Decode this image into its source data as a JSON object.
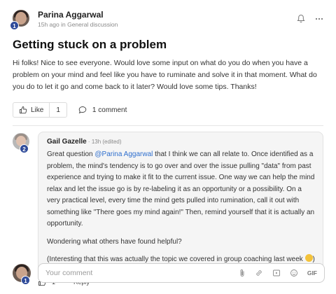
{
  "post": {
    "author": "Parina Aggarwal",
    "author_badge": "1",
    "timestamp": "15h ago in",
    "group": "General discussion",
    "title": "Getting stuck on a problem",
    "body": "Hi folks! Nice to see everyone. Would love some input on what do you do when you have a problem on your mind and feel like you have to ruminate and solve it in that moment. What do you do to let it go and come back to it later? Would love some tips. Thanks!",
    "like_label": "Like",
    "like_count": "1",
    "comment_count_label": "1 comment"
  },
  "comment": {
    "author": "Gail Gazelle",
    "author_badge": "2",
    "timestamp": " · 13h (edited)",
    "text_before_mention": "Great question ",
    "mention": "@Parina Aggarwal",
    "text_after_mention": " that I think we can all relate to. Once identified as a problem, the mind's tendency is to go over and over the issue pulling \"data\" from past experience and trying to make it fit to the current issue. One way we can help the mind relax and let the issue go is by re-labeling it as an opportunity or a possibility. On a very practical level, every time the mind gets pulled into rumination, call it out with something like \"There goes my mind again!\" Then, remind yourself that it is actually an opportunity.",
    "paragraph_2": "Wondering what others have found helpful?",
    "paragraph_3": "(Interesting that this was actually the topic we covered in group coaching last week ",
    "paragraph_3_end": ")",
    "like_count": "1",
    "reply_label": "Reply"
  },
  "reply_box": {
    "placeholder": "Your comment",
    "user_badge": "1",
    "gif_label": "GIF"
  },
  "colors": {
    "accent": "#2f6fce",
    "badge": "#2f4b9a"
  }
}
